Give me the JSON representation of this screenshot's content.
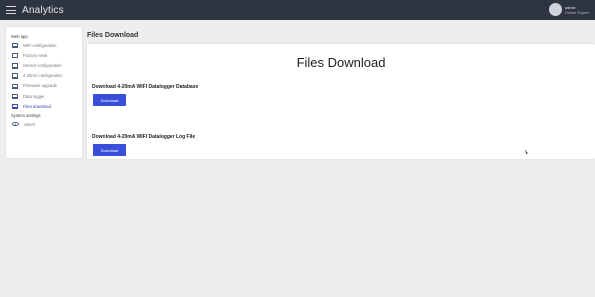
{
  "header": {
    "brand": "Analytics",
    "user_name": "admin",
    "user_status": "Online Expert"
  },
  "sidebar": {
    "sections": [
      {
        "title": "Web app",
        "items": [
          {
            "label": "WiFi configuration",
            "icon": "monitor-icon",
            "active": false
          },
          {
            "label": "Factory reset",
            "icon": "monitor-icon",
            "active": false
          },
          {
            "label": "Sensor configuration",
            "icon": "monitor-icon",
            "active": false
          },
          {
            "label": "4-20mA configuration",
            "icon": "monitor-icon",
            "active": false
          },
          {
            "label": "Firmware upgrade",
            "icon": "monitor-icon",
            "active": false
          },
          {
            "label": "Data logger",
            "icon": "monitor-icon",
            "active": false
          },
          {
            "label": "Files download",
            "icon": "monitor-icon",
            "active": true
          }
        ]
      },
      {
        "title": "System settings",
        "items": [
          {
            "label": "Users",
            "icon": "eye-icon",
            "active": false
          }
        ]
      }
    ]
  },
  "main": {
    "page_header": "Files Download",
    "card_title": "Files Download",
    "downloads": [
      {
        "title": "Download 4-20mA WIFI Datalogger Database",
        "button_label": "Download"
      },
      {
        "title": "Download 4-20mA WIFI Datalogger Log File",
        "button_label": "Download"
      }
    ]
  },
  "colors": {
    "topbar": "#2f3441",
    "button": "#3a4fd9",
    "active_nav": "#3947a8",
    "background": "#eeeeee"
  }
}
